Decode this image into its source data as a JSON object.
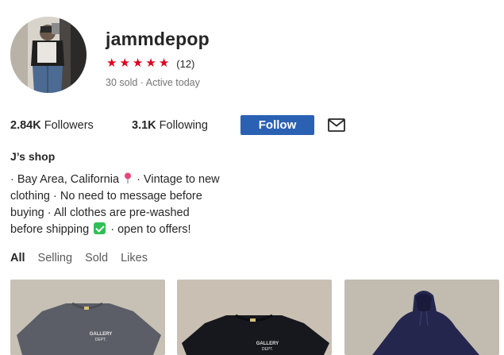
{
  "profile": {
    "username": "jammdepop",
    "rating_stars": 5,
    "review_count": "(12)",
    "sold": "30 sold",
    "separator": "·",
    "active_status": "Active today"
  },
  "stats": {
    "followers_count": "2.84K",
    "followers_label": "Followers",
    "following_count": "3.1K",
    "following_label": "Following"
  },
  "actions": {
    "follow_label": "Follow"
  },
  "shop": {
    "name": "J’s shop",
    "bio": {
      "line1_a": "· Bay Area, California",
      "line1_b": "· Vintage to new",
      "line2": "clothing · No need to message before",
      "line3": "buying · All clothes are pre-washed",
      "line4_a": "before shipping",
      "line4_b": "· open to offers!"
    }
  },
  "tabs": [
    "All",
    "Selling",
    "Sold",
    "Likes"
  ],
  "active_tab": "All",
  "products": [
    {
      "logo_text_1": "GALLERY",
      "logo_text_2": "DEPT."
    },
    {
      "logo_text_1": "GALLERY",
      "logo_text_2": "DEPT."
    },
    {}
  ],
  "colors": {
    "star": "#e1001d",
    "follow_button": "#2b61b3",
    "checkmark": "#2fbf54",
    "pin": "#e8467c"
  },
  "icons": {
    "star": "star-icon",
    "mail": "mail-icon",
    "pin": "round-pushpin-icon",
    "check": "check-mark-button-icon"
  }
}
